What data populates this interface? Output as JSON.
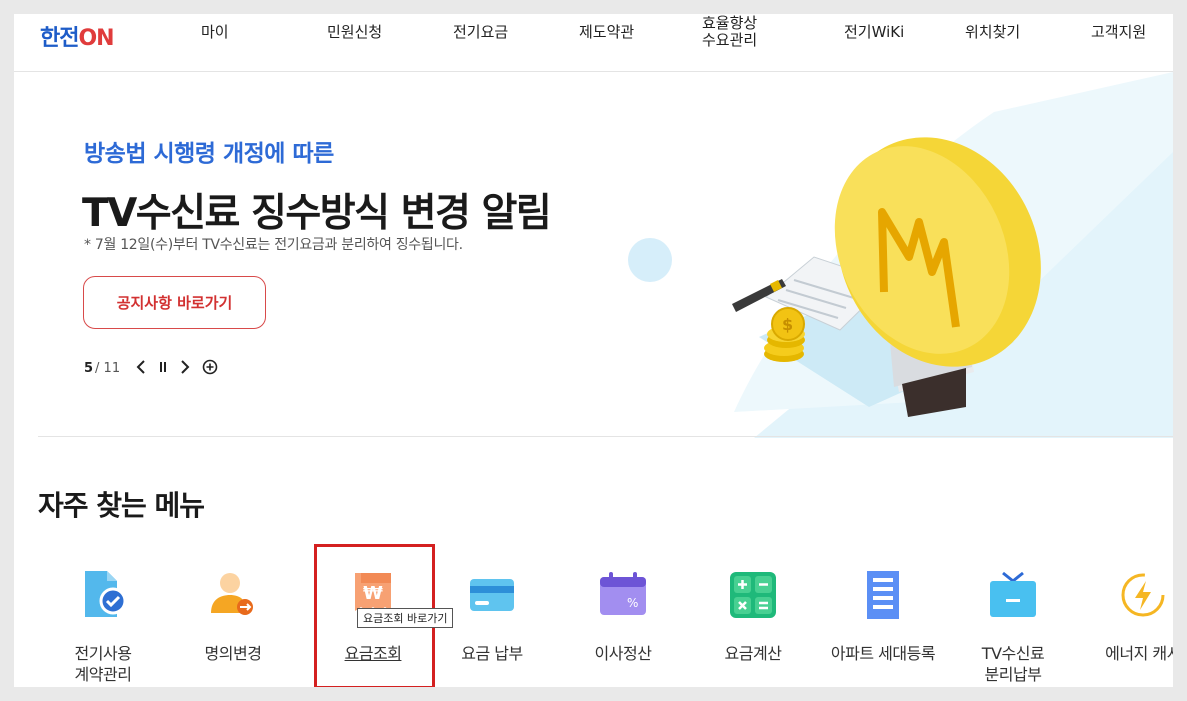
{
  "header": {
    "logo_main": "한전",
    "logo_on": "ON",
    "nav": [
      {
        "label": "마이"
      },
      {
        "label": "민원신청"
      },
      {
        "label": "전기요금"
      },
      {
        "label": "제도약관"
      },
      {
        "label": "효율향상\n수요관리"
      },
      {
        "label": "전기WiKi"
      },
      {
        "label": "위치찾기"
      },
      {
        "label": "고객지원"
      }
    ]
  },
  "hero": {
    "subtitle": "방송법 시행령 개정에 따른",
    "title": "TV수신료 징수방식 변경 알림",
    "notice": "* 7월 12일(수)부터 TV수신료는 전기요금과 분리하여 징수됩니다.",
    "cta_label": "공지사항 바로가기",
    "slide_current": "5",
    "slide_total": "/ 11",
    "prev_icon": "chevron-left",
    "pause_icon": "pause",
    "next_icon": "chevron-right",
    "more_icon": "circle-plus"
  },
  "favorites": {
    "title": "자주 찾는 메뉴",
    "items": [
      {
        "label": "전기사용\n계약관리",
        "icon": "document-check-icon"
      },
      {
        "label": "명의변경",
        "icon": "person-change-icon"
      },
      {
        "label": "요금조회",
        "icon": "won-receipt-icon"
      },
      {
        "label": "요금 납부",
        "icon": "card-icon"
      },
      {
        "label": "이사정산",
        "icon": "calendar-percent-icon"
      },
      {
        "label": "요금계산",
        "icon": "calculator-icon"
      },
      {
        "label": "아파트 세대등록",
        "icon": "building-icon"
      },
      {
        "label": "TV수신료\n분리납부",
        "icon": "tv-icon"
      },
      {
        "label": "에너지 캐시",
        "icon": "energy-bolt-icon"
      }
    ],
    "tooltip": "요금조회 바로가기"
  },
  "colors": {
    "accent_blue": "#2d6ad6",
    "accent_red": "#d23131",
    "highlight": "#d42020"
  }
}
